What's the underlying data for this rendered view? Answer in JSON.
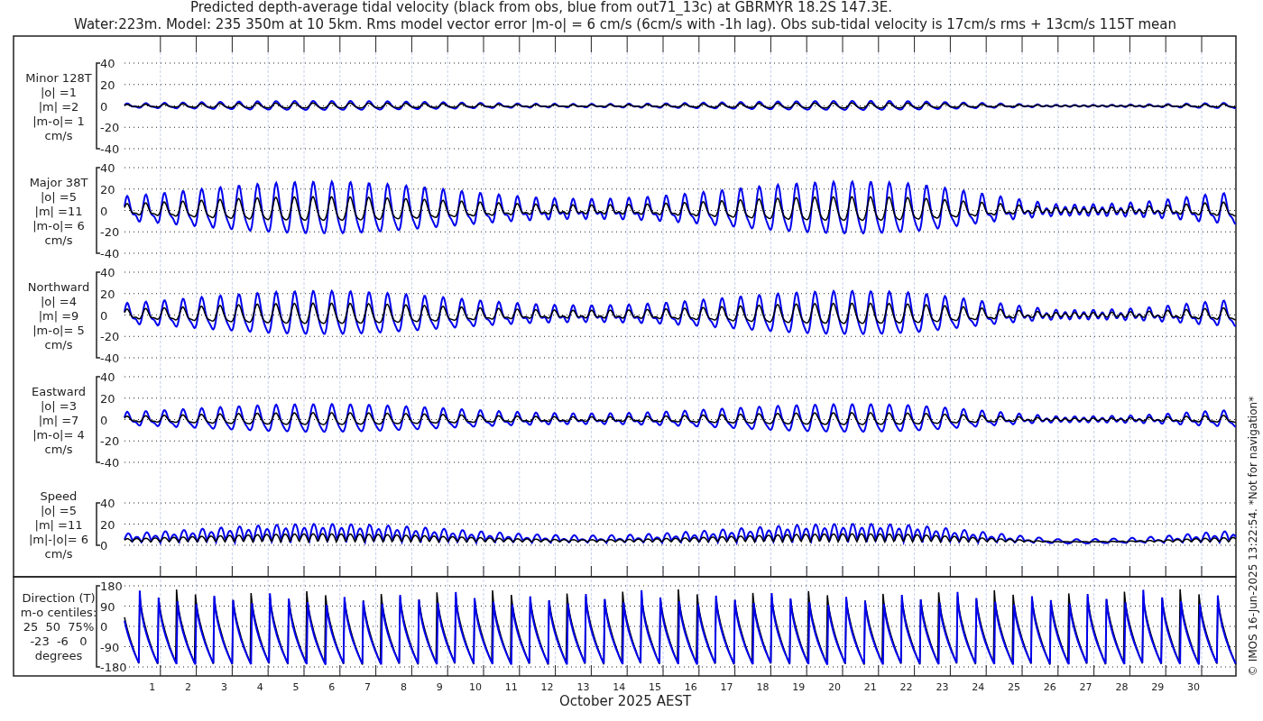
{
  "title_lines": [
    "Predicted depth-average tidal velocity (black from obs, blue from out71_13c) at GBRMYR 18.2S 147.3E.",
    "Water:223m. Model: 235 350m at 10 5km. Rms model vector error |m-o| = 6 cm/s (6cm/s with -1h lag). Obs sub-tidal velocity is 17cm/s rms + 13cm/s 115T mean"
  ],
  "panels": [
    {
      "kind": "wave",
      "label_lines": [
        "Minor 128T",
        "|o| =1",
        "|m| =2",
        "|m-o|= 1",
        "cm/s"
      ],
      "yticks": [
        "40",
        "20",
        "0",
        "-20",
        "-40"
      ]
    },
    {
      "kind": "wave",
      "label_lines": [
        "Major 38T",
        "|o| =5",
        "|m| =11",
        "|m-o|= 6",
        "cm/s"
      ],
      "yticks": [
        "40",
        "20",
        "0",
        "-20",
        "-40"
      ]
    },
    {
      "kind": "wave",
      "label_lines": [
        "Northward",
        "|o| =4",
        "|m| =9",
        "|m-o|= 5",
        "cm/s"
      ],
      "yticks": [
        "40",
        "20",
        "0",
        "-20",
        "-40"
      ]
    },
    {
      "kind": "wave",
      "label_lines": [
        "Eastward",
        "|o| =3",
        "|m| =7",
        "|m-o|= 4",
        "cm/s"
      ],
      "yticks": [
        "40",
        "20",
        "0",
        "-20",
        "-40"
      ]
    },
    {
      "kind": "speed",
      "label_lines": [
        "Speed",
        "|o| =5",
        "|m| =11",
        "|m|-|o|= 6",
        "cm/s"
      ],
      "yticks": [
        "40",
        "20",
        "0"
      ]
    },
    {
      "kind": "direction",
      "label_lines": [
        "Direction (T)",
        "m-o centiles:",
        "25  50  75%",
        "-23  -6   0",
        "degrees"
      ],
      "yticks": [
        "180",
        "90",
        "0",
        "-90",
        "-180"
      ]
    }
  ],
  "xticks": [
    "1",
    "2",
    "3",
    "4",
    "5",
    "6",
    "7",
    "8",
    "9",
    "10",
    "11",
    "12",
    "13",
    "14",
    "15",
    "16",
    "17",
    "18",
    "19",
    "20",
    "21",
    "22",
    "23",
    "24",
    "25",
    "26",
    "27",
    "28",
    "29",
    "30"
  ],
  "xlabel": "October 2025 AEST",
  "side_note": "© IMOS 16-Jun-2025 13:22:54. *Not for navigation*"
}
